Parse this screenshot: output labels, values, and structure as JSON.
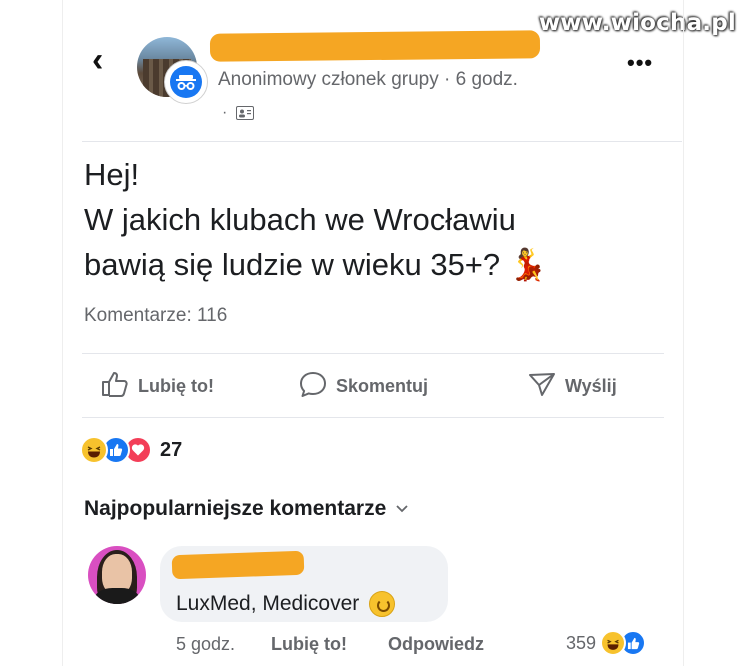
{
  "watermark": "www.wiocha.pl",
  "post": {
    "author": "Anonimowy członek grupy",
    "time": "6 godz.",
    "audience_dot": "·",
    "audience_icon": "members-icon",
    "text_lines": [
      "Hej!",
      "W jakich klubach we Wrocławiu",
      "bawią się ludzie w wieku 35+? 💃"
    ],
    "comments_label": "Komentarze: 116"
  },
  "actions": {
    "like": "Lubię to!",
    "comment": "Skomentuj",
    "share": "Wyślij"
  },
  "reactions": {
    "count": "27",
    "types": [
      "haha",
      "like",
      "love"
    ]
  },
  "comments_sort": "Najpopularniejsze komentarze",
  "comment": {
    "text": "LuxMed, Medicover",
    "time": "5 godz.",
    "like": "Lubię to!",
    "reply": "Odpowiedz",
    "reaction_count": "359",
    "reaction_types": [
      "haha",
      "like"
    ]
  },
  "colors": {
    "brand_blue": "#1877f2",
    "redaction": "#f5a623",
    "secondary_text": "#65676b",
    "love_red": "#f33e58",
    "haha_yellow": "#f7c22d"
  }
}
